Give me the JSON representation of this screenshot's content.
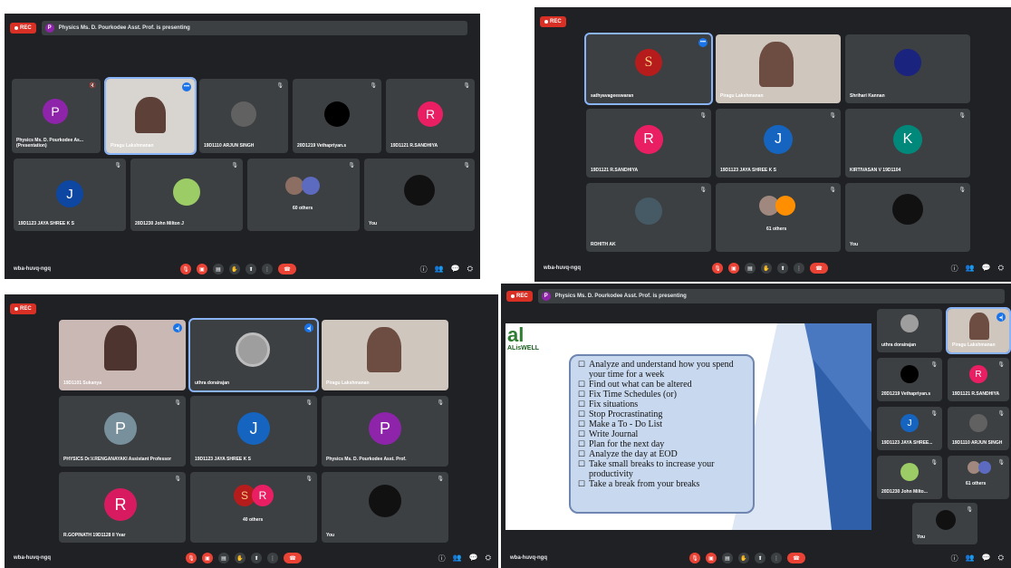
{
  "colors": {
    "rec": "#d93025",
    "panel": "#202124",
    "tile": "#3c4043",
    "accent": "#8ab4f8",
    "end_call": "#ea4335"
  },
  "icons": [
    "mic-off-icon",
    "camera-off-icon",
    "captions-icon",
    "hand-icon",
    "present-icon",
    "more-icon",
    "end-call-icon",
    "info-icon",
    "people-icon",
    "chat-icon",
    "activities-icon"
  ],
  "rec_label": "REC",
  "meeting_code": "wba-huvq-ngq",
  "panel1": {
    "presenting": "Physics Ms. D. Pourkodee Asst. Prof. is presenting",
    "tiles": [
      {
        "initial": "P",
        "name": "Physics Ms. D. Pourkodee As... (Presentation)"
      },
      {
        "name": "Piragu Lakshmanan"
      },
      {
        "name": "19D1110 ARJUN SINGH"
      },
      {
        "name": "20D1219 Vethapriyan.s"
      },
      {
        "initial": "R",
        "name": "19D1121 R.SANDHIYA"
      },
      {
        "initial": "J",
        "name": "19D1123 JAYA SHREE K S"
      },
      {
        "name": "20D1230 John Milton J"
      },
      {
        "others": "60 others"
      },
      {
        "name": "You"
      }
    ],
    "participants_badge": "60"
  },
  "panel2": {
    "tiles": [
      {
        "initial": "S",
        "name": "sathyavageeswaran"
      },
      {
        "name": "Piragu Lakshmanan"
      },
      {
        "name": "Shrihari Kannan"
      },
      {
        "initial": "R",
        "name": "19D1121 R.SANDHIYA"
      },
      {
        "initial": "J",
        "name": "19D1123 JAYA SHREE K S"
      },
      {
        "initial": "K",
        "name": "KIRTIVASAN V 19D1104"
      },
      {
        "name": "ROHITH AK"
      },
      {
        "others": "61 others"
      },
      {
        "name": "You"
      }
    ],
    "participants_badge": "68"
  },
  "panel3": {
    "tiles": [
      {
        "name": "19D1101 Sukanya"
      },
      {
        "name": "uthra dorairajan"
      },
      {
        "name": "Piragu Lakshmanan"
      },
      {
        "initial": "P",
        "name": "PHYSICS Dr.V.RENGANAYAKI Assistant Professor"
      },
      {
        "initial": "J",
        "name": "19D1123 JAYA SHREE K S"
      },
      {
        "initial": "P",
        "name": "Physics Ms. D. Pourkodee Asst. Prof."
      },
      {
        "initial": "R",
        "name": "R.GOPINATH 19D1128 II Year"
      },
      {
        "others": "40 others",
        "initials": [
          "S",
          "R"
        ]
      },
      {
        "name": "You"
      }
    ],
    "participants_badge": "68"
  },
  "panel4": {
    "presenting": "Physics Ms. D. Pourkodee Asst. Prof. is presenting",
    "logo": {
      "mark": "al",
      "text": "ALisWELL"
    },
    "slide_items": [
      "Analyze and understand how you spend your time for a week",
      "Find out what can be altered",
      "Fix Time Schedules (or)",
      "Fix situations",
      "Stop Procrastinating",
      "Make a To - Do List",
      "Write Journal",
      "Plan for the next day",
      "Analyze the day at EOD",
      "Take small breaks to increase your productivity",
      "Take a break from your breaks"
    ],
    "tiles": [
      {
        "name": "uthra dorairajan"
      },
      {
        "name": "Piragu Lakshmanan"
      },
      {
        "name": "20D1219 Vethapriyan.s"
      },
      {
        "initial": "R",
        "name": "19D1121 R.SANDHIYA"
      },
      {
        "initial": "J",
        "name": "19D1123 JAYA SHREE..."
      },
      {
        "name": "19D1110 ARJUN SINGH"
      },
      {
        "name": "20D1230 John Milto..."
      },
      {
        "others": "61 others"
      },
      {
        "name": "You"
      }
    ],
    "participants_badge": "70"
  }
}
